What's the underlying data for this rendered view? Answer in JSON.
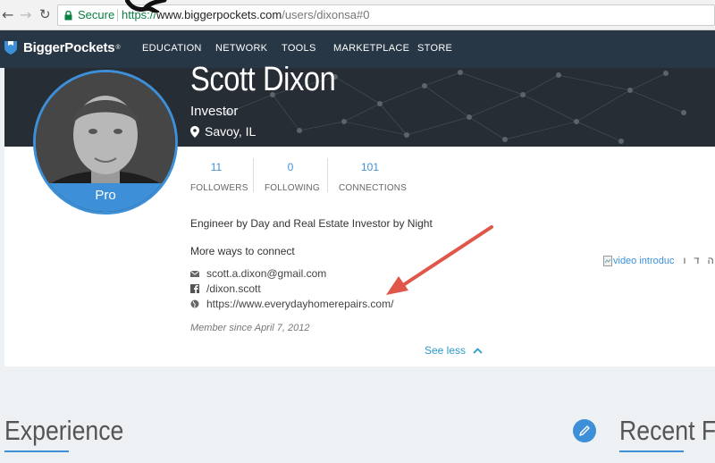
{
  "browser": {
    "secure_label": "Secure",
    "url_protocol": "https://",
    "url_host": "www.biggerpockets.com",
    "url_path": "/users/dixonsa#0"
  },
  "site_nav": {
    "logo_text": "BiggerPockets",
    "logo_mark": "®",
    "items": [
      "EDUCATION",
      "NETWORK",
      "TOOLS",
      "MARKETPLACE",
      "STORE"
    ]
  },
  "profile": {
    "name": "Scott Dixon",
    "role": "Investor",
    "location": "Savoy, IL",
    "badge": "Pro",
    "stats": [
      {
        "value": "11",
        "label": "FOLLOWERS"
      },
      {
        "value": "0",
        "label": "FOLLOWING"
      },
      {
        "value": "101",
        "label": "CONNECTIONS"
      }
    ],
    "bio": "Engineer by Day and Real Estate Investor by Night",
    "more_ways_heading": "More ways to connect",
    "contacts": {
      "email": "scott.a.dixon@gmail.com",
      "facebook": "/dixon.scott",
      "website": "https://www.everydayhomerepairs.com/"
    },
    "member_since": "Member since April 7, 2012",
    "see_less": "See less",
    "video_alt": "video introduc",
    "video_alt_tail": "ה ד ו"
  },
  "sections": {
    "experience": "Experience",
    "recent": "Recent Fo"
  },
  "colors": {
    "accent": "#3d90d8",
    "nav_bg": "#283745",
    "arrow": "#e0574a"
  },
  "icons": [
    "lock-icon",
    "pin-icon",
    "mail-icon",
    "facebook-icon",
    "globe-icon",
    "chevron-up-icon",
    "pencil-icon"
  ]
}
